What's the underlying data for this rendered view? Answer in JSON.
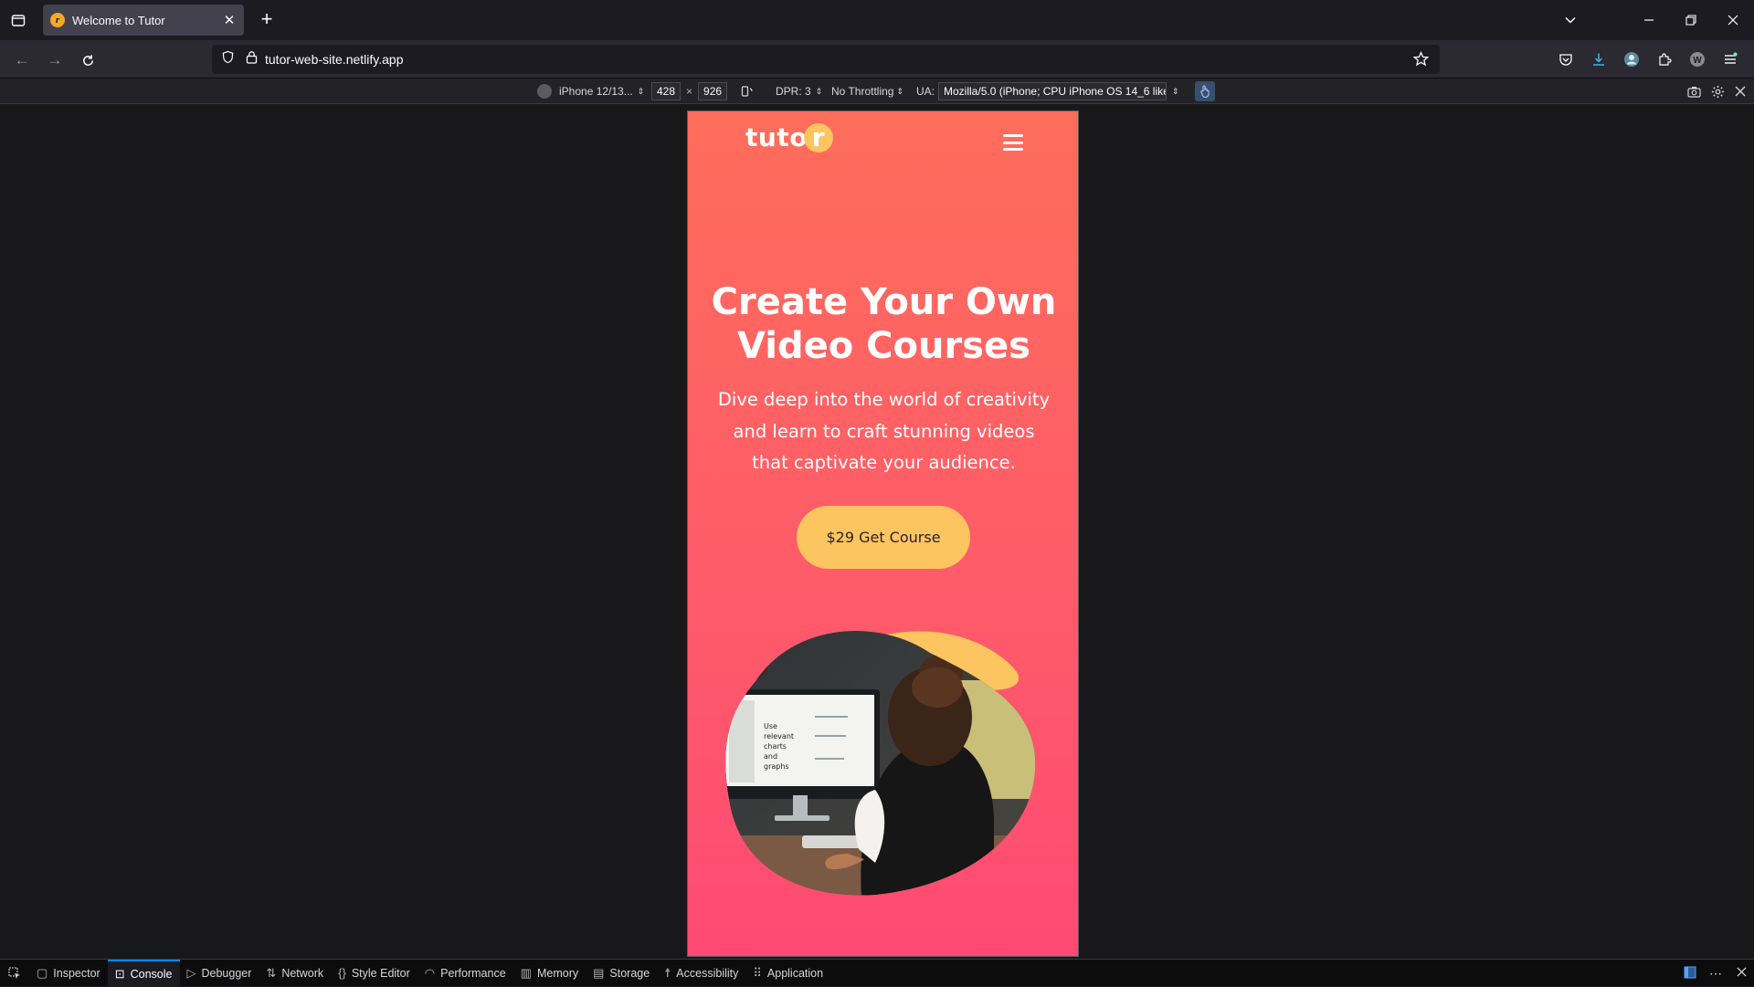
{
  "browser": {
    "tab": {
      "title": "Welcome to Tutor",
      "favicon_letter": "r"
    },
    "url": "tutor-web-site.netlify.app"
  },
  "rdm": {
    "device": "iPhone 12/13...",
    "width": "428",
    "times": "×",
    "height": "926",
    "dpr": "DPR: 3",
    "throttling": "No Throttling",
    "ua_label": "UA:",
    "ua_value": "Mozilla/5.0 (iPhone; CPU iPhone OS 14_6 like l"
  },
  "site": {
    "logo_text": "tuto",
    "logo_letter": "r",
    "hero_title_line1": "Create Your Own",
    "hero_title_line2": "Video Courses",
    "hero_text": "Dive deep into the world of creativity and learn to craft stunning videos that captivate your audience.",
    "cta_label": "$29 Get Course",
    "image_text": [
      "Use",
      "relevant",
      "charts",
      "and",
      "graphs"
    ],
    "colors": {
      "primary": "#fe5a6a",
      "accent": "#fdc55f"
    }
  },
  "devtools": {
    "tabs": [
      {
        "label": "Inspector",
        "icon": "inspector-icon"
      },
      {
        "label": "Console",
        "icon": "console-icon",
        "active": true
      },
      {
        "label": "Debugger",
        "icon": "debugger-icon"
      },
      {
        "label": "Network",
        "icon": "network-icon"
      },
      {
        "label": "Style Editor",
        "icon": "style-editor-icon"
      },
      {
        "label": "Performance",
        "icon": "performance-icon"
      },
      {
        "label": "Memory",
        "icon": "memory-icon"
      },
      {
        "label": "Storage",
        "icon": "storage-icon"
      },
      {
        "label": "Accessibility",
        "icon": "accessibility-icon"
      },
      {
        "label": "Application",
        "icon": "application-icon"
      }
    ]
  }
}
